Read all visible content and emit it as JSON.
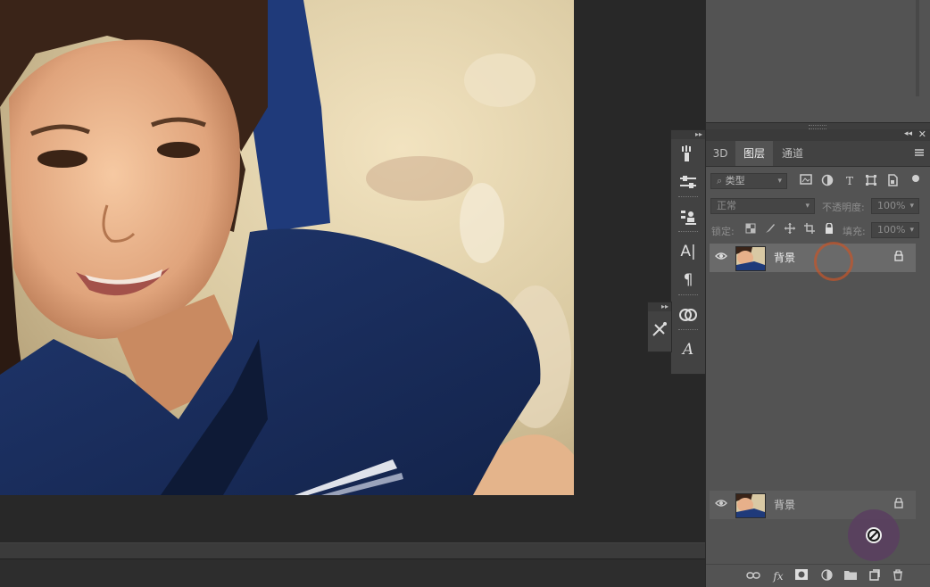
{
  "colors": {
    "workspace_bg": "#282828",
    "panel_bg": "#535353",
    "selected_layer_bg": "#6a6a6a",
    "cursor_ring": "#c8552a",
    "bubble_bg": "#5a4060"
  },
  "layers_panel": {
    "tabs": [
      {
        "label": "3D",
        "active": false
      },
      {
        "label": "图层",
        "active": true
      },
      {
        "label": "通道",
        "active": false
      }
    ],
    "filter": {
      "selected": "类型"
    },
    "blend_mode": {
      "selected": "正常"
    },
    "opacity": {
      "label": "不透明度:",
      "value": "100%"
    },
    "lock": {
      "label": "锁定:"
    },
    "fill": {
      "label": "填充:",
      "value": "100%"
    },
    "layers": [
      {
        "name": "背景",
        "locked": true,
        "visible": true,
        "selected": true
      },
      {
        "name": "背景",
        "locked": true,
        "visible": true,
        "dragging": true
      }
    ],
    "bottom_icons": [
      "link-icon",
      "fx-icon",
      "mask-icon",
      "adjustment-icon",
      "folder-icon",
      "new-layer-icon",
      "trash-icon"
    ]
  },
  "icons": {
    "fx_label": "fx",
    "type_label": "T",
    "char_label": "A|",
    "para_label": "¶",
    "glyph_label": "A"
  }
}
